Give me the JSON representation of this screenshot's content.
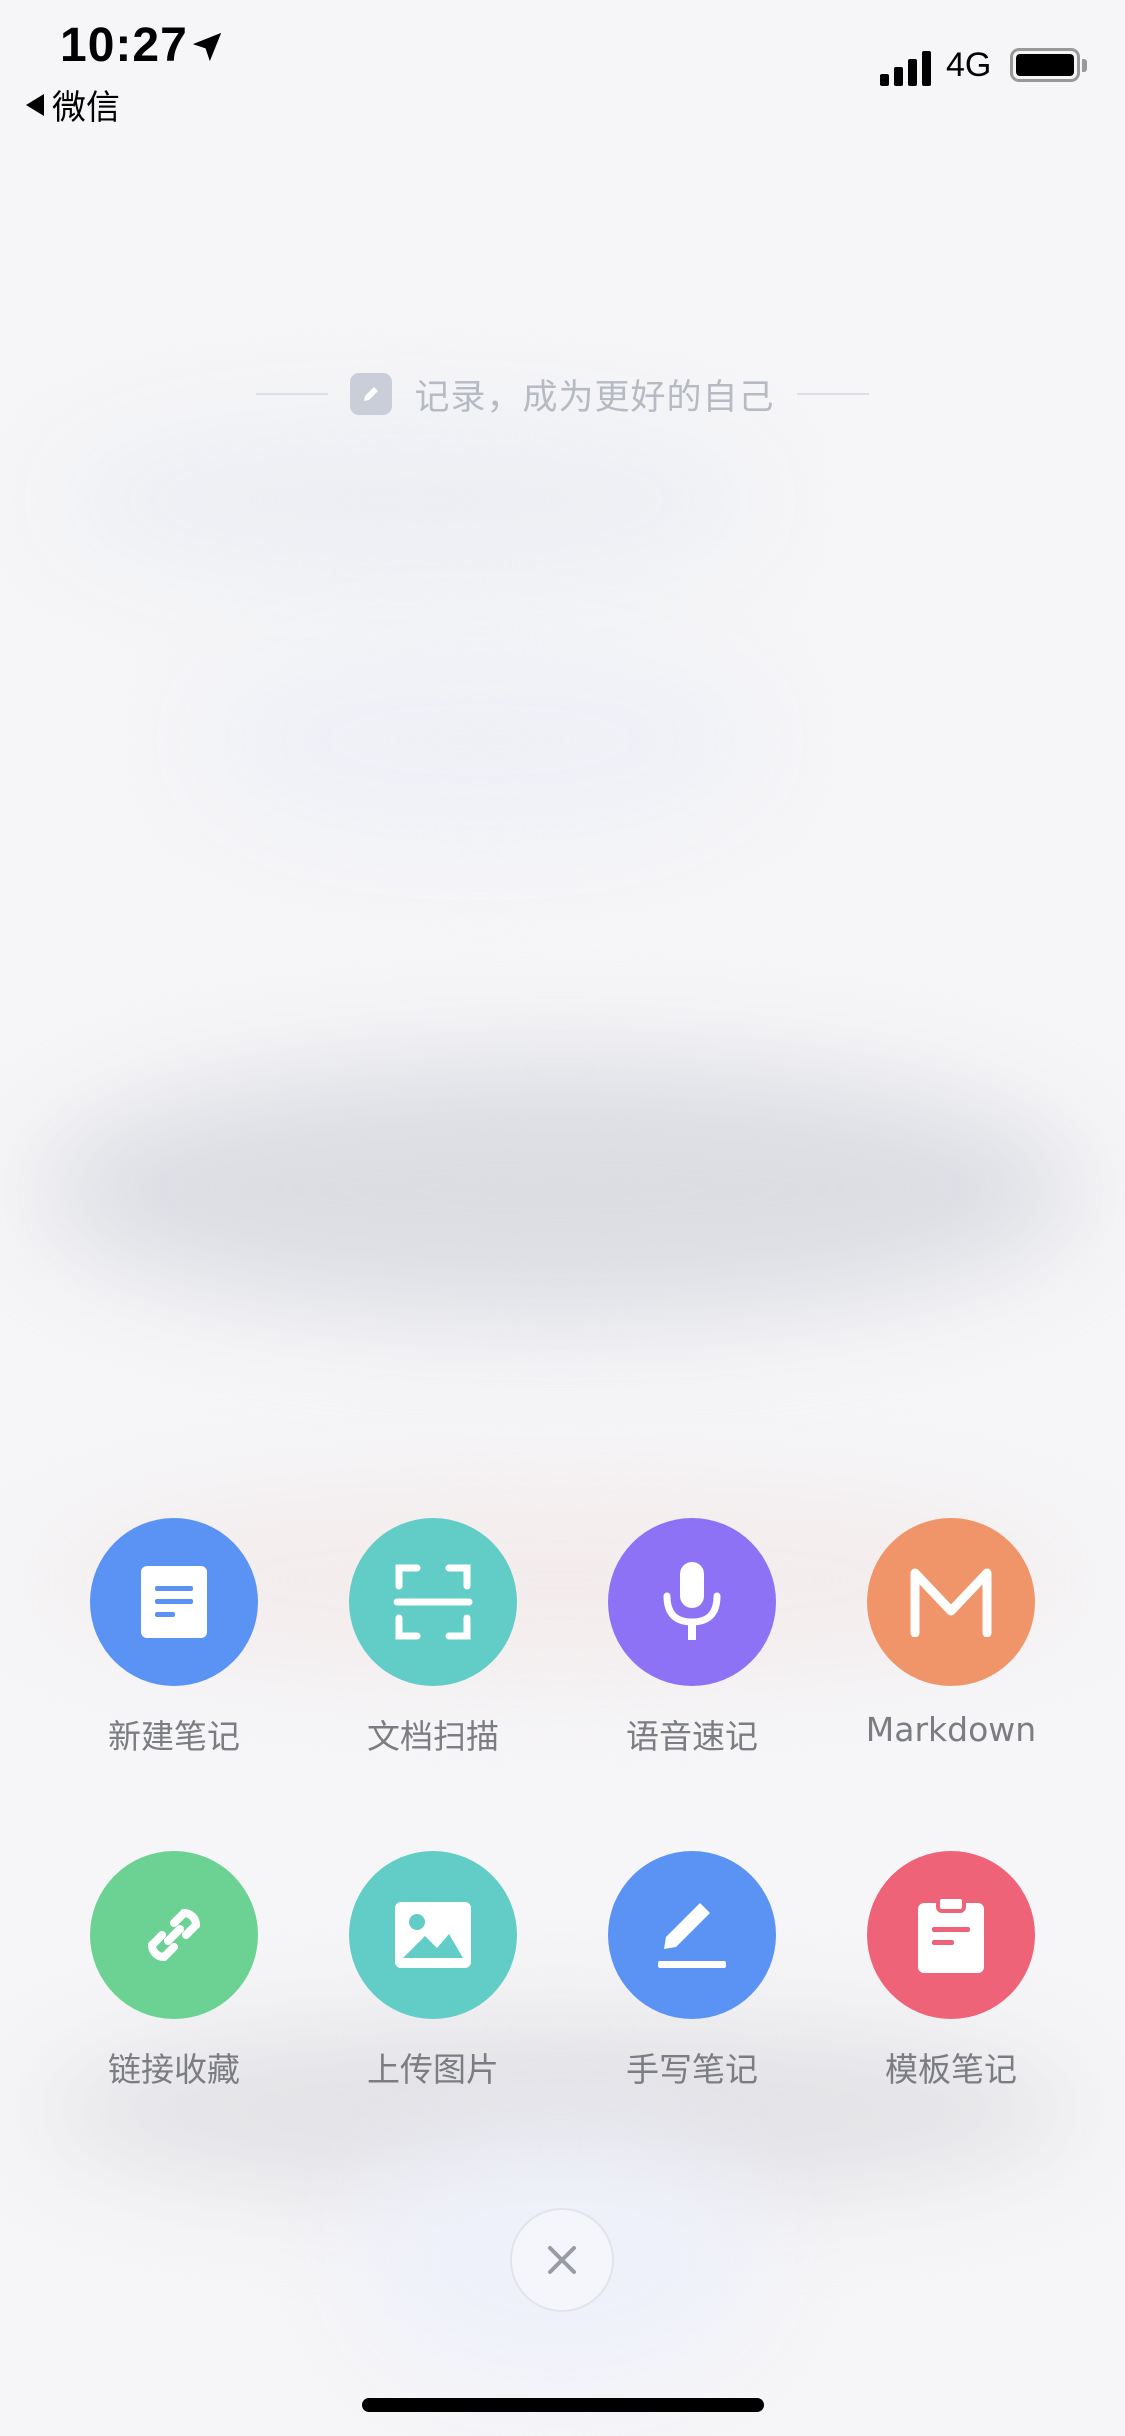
{
  "status_bar": {
    "time": "10:27",
    "back_app": "微信",
    "network": "4G"
  },
  "slogan": "记录，成为更好的自己",
  "actions": [
    {
      "label": "新建笔记",
      "icon": "document-icon",
      "color": "#5b93f5"
    },
    {
      "label": "文档扫描",
      "icon": "scan-icon",
      "color": "#62ccc6"
    },
    {
      "label": "语音速记",
      "icon": "microphone-icon",
      "color": "#8e72f5"
    },
    {
      "label": "Markdown",
      "icon": "markdown-m-icon",
      "color": "#f0956a"
    },
    {
      "label": "链接收藏",
      "icon": "link-icon",
      "color": "#6bd293"
    },
    {
      "label": "上传图片",
      "icon": "image-icon",
      "color": "#62ccc6"
    },
    {
      "label": "手写笔记",
      "icon": "pen-icon",
      "color": "#5b93f5"
    },
    {
      "label": "模板笔记",
      "icon": "clipboard-icon",
      "color": "#ee6378"
    }
  ],
  "close_icon": "close-icon"
}
